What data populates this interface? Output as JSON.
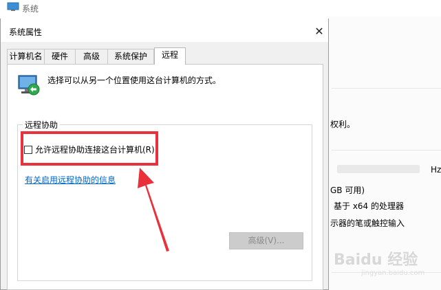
{
  "background_window": {
    "title": "系统",
    "lines": [
      "权利。",
      "Hz",
      "GB 可用)",
      "基于 x64 的处理器",
      "示器的笔或触控输入"
    ]
  },
  "dialog": {
    "title": "系统属性",
    "close_glyph": "✕",
    "tabs": [
      {
        "label": "计算机名",
        "active": false
      },
      {
        "label": "硬件",
        "active": false
      },
      {
        "label": "高级",
        "active": false
      },
      {
        "label": "系统保护",
        "active": false
      },
      {
        "label": "远程",
        "active": true
      }
    ],
    "description": "选择可以从另一个位置使用这台计算机的方式。",
    "remote_assistance": {
      "group_label": "远程协助",
      "checkbox_label": "允许远程协助连接这台计算机(R)",
      "checked": false,
      "link_text": "有关启用远程协助的信息",
      "advanced_button": "高级(V)...",
      "advanced_enabled": false
    }
  },
  "annotation": {
    "color": "#e8313a"
  },
  "watermark": {
    "text": "Baidu 经验",
    "subtext": "jingyan.baidu.com"
  }
}
